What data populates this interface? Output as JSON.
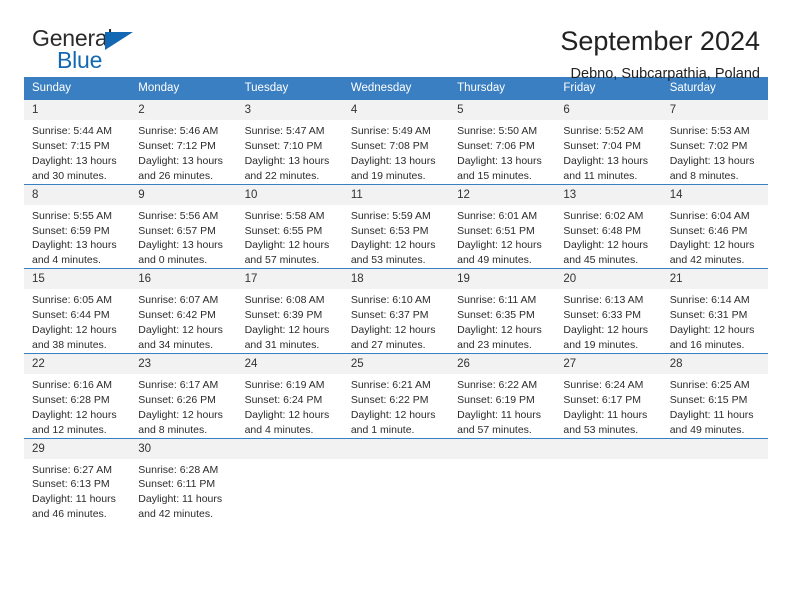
{
  "brand": {
    "name_top": "General",
    "name_bottom": "Blue",
    "accent_color": "#1268b3"
  },
  "header": {
    "title": "September 2024",
    "subtitle": "Debno, Subcarpathia, Poland"
  },
  "theme": {
    "header_blue": "#3a7fc1",
    "daynum_bg": "#f2f2f2",
    "text": "#222222"
  },
  "labels": {
    "sunrise_prefix": "Sunrise:",
    "sunset_prefix": "Sunset:",
    "daylight_prefix": "Daylight:"
  },
  "weekdays": [
    "Sunday",
    "Monday",
    "Tuesday",
    "Wednesday",
    "Thursday",
    "Friday",
    "Saturday"
  ],
  "weeks": [
    [
      {
        "day": "1",
        "sunrise": "Sunrise: 5:44 AM",
        "sunset": "Sunset: 7:15 PM",
        "daylight_line1": "Daylight: 13 hours",
        "daylight_line2": "and 30 minutes."
      },
      {
        "day": "2",
        "sunrise": "Sunrise: 5:46 AM",
        "sunset": "Sunset: 7:12 PM",
        "daylight_line1": "Daylight: 13 hours",
        "daylight_line2": "and 26 minutes."
      },
      {
        "day": "3",
        "sunrise": "Sunrise: 5:47 AM",
        "sunset": "Sunset: 7:10 PM",
        "daylight_line1": "Daylight: 13 hours",
        "daylight_line2": "and 22 minutes."
      },
      {
        "day": "4",
        "sunrise": "Sunrise: 5:49 AM",
        "sunset": "Sunset: 7:08 PM",
        "daylight_line1": "Daylight: 13 hours",
        "daylight_line2": "and 19 minutes."
      },
      {
        "day": "5",
        "sunrise": "Sunrise: 5:50 AM",
        "sunset": "Sunset: 7:06 PM",
        "daylight_line1": "Daylight: 13 hours",
        "daylight_line2": "and 15 minutes."
      },
      {
        "day": "6",
        "sunrise": "Sunrise: 5:52 AM",
        "sunset": "Sunset: 7:04 PM",
        "daylight_line1": "Daylight: 13 hours",
        "daylight_line2": "and 11 minutes."
      },
      {
        "day": "7",
        "sunrise": "Sunrise: 5:53 AM",
        "sunset": "Sunset: 7:02 PM",
        "daylight_line1": "Daylight: 13 hours",
        "daylight_line2": "and 8 minutes."
      }
    ],
    [
      {
        "day": "8",
        "sunrise": "Sunrise: 5:55 AM",
        "sunset": "Sunset: 6:59 PM",
        "daylight_line1": "Daylight: 13 hours",
        "daylight_line2": "and 4 minutes."
      },
      {
        "day": "9",
        "sunrise": "Sunrise: 5:56 AM",
        "sunset": "Sunset: 6:57 PM",
        "daylight_line1": "Daylight: 13 hours",
        "daylight_line2": "and 0 minutes."
      },
      {
        "day": "10",
        "sunrise": "Sunrise: 5:58 AM",
        "sunset": "Sunset: 6:55 PM",
        "daylight_line1": "Daylight: 12 hours",
        "daylight_line2": "and 57 minutes."
      },
      {
        "day": "11",
        "sunrise": "Sunrise: 5:59 AM",
        "sunset": "Sunset: 6:53 PM",
        "daylight_line1": "Daylight: 12 hours",
        "daylight_line2": "and 53 minutes."
      },
      {
        "day": "12",
        "sunrise": "Sunrise: 6:01 AM",
        "sunset": "Sunset: 6:51 PM",
        "daylight_line1": "Daylight: 12 hours",
        "daylight_line2": "and 49 minutes."
      },
      {
        "day": "13",
        "sunrise": "Sunrise: 6:02 AM",
        "sunset": "Sunset: 6:48 PM",
        "daylight_line1": "Daylight: 12 hours",
        "daylight_line2": "and 45 minutes."
      },
      {
        "day": "14",
        "sunrise": "Sunrise: 6:04 AM",
        "sunset": "Sunset: 6:46 PM",
        "daylight_line1": "Daylight: 12 hours",
        "daylight_line2": "and 42 minutes."
      }
    ],
    [
      {
        "day": "15",
        "sunrise": "Sunrise: 6:05 AM",
        "sunset": "Sunset: 6:44 PM",
        "daylight_line1": "Daylight: 12 hours",
        "daylight_line2": "and 38 minutes."
      },
      {
        "day": "16",
        "sunrise": "Sunrise: 6:07 AM",
        "sunset": "Sunset: 6:42 PM",
        "daylight_line1": "Daylight: 12 hours",
        "daylight_line2": "and 34 minutes."
      },
      {
        "day": "17",
        "sunrise": "Sunrise: 6:08 AM",
        "sunset": "Sunset: 6:39 PM",
        "daylight_line1": "Daylight: 12 hours",
        "daylight_line2": "and 31 minutes."
      },
      {
        "day": "18",
        "sunrise": "Sunrise: 6:10 AM",
        "sunset": "Sunset: 6:37 PM",
        "daylight_line1": "Daylight: 12 hours",
        "daylight_line2": "and 27 minutes."
      },
      {
        "day": "19",
        "sunrise": "Sunrise: 6:11 AM",
        "sunset": "Sunset: 6:35 PM",
        "daylight_line1": "Daylight: 12 hours",
        "daylight_line2": "and 23 minutes."
      },
      {
        "day": "20",
        "sunrise": "Sunrise: 6:13 AM",
        "sunset": "Sunset: 6:33 PM",
        "daylight_line1": "Daylight: 12 hours",
        "daylight_line2": "and 19 minutes."
      },
      {
        "day": "21",
        "sunrise": "Sunrise: 6:14 AM",
        "sunset": "Sunset: 6:31 PM",
        "daylight_line1": "Daylight: 12 hours",
        "daylight_line2": "and 16 minutes."
      }
    ],
    [
      {
        "day": "22",
        "sunrise": "Sunrise: 6:16 AM",
        "sunset": "Sunset: 6:28 PM",
        "daylight_line1": "Daylight: 12 hours",
        "daylight_line2": "and 12 minutes."
      },
      {
        "day": "23",
        "sunrise": "Sunrise: 6:17 AM",
        "sunset": "Sunset: 6:26 PM",
        "daylight_line1": "Daylight: 12 hours",
        "daylight_line2": "and 8 minutes."
      },
      {
        "day": "24",
        "sunrise": "Sunrise: 6:19 AM",
        "sunset": "Sunset: 6:24 PM",
        "daylight_line1": "Daylight: 12 hours",
        "daylight_line2": "and 4 minutes."
      },
      {
        "day": "25",
        "sunrise": "Sunrise: 6:21 AM",
        "sunset": "Sunset: 6:22 PM",
        "daylight_line1": "Daylight: 12 hours",
        "daylight_line2": "and 1 minute."
      },
      {
        "day": "26",
        "sunrise": "Sunrise: 6:22 AM",
        "sunset": "Sunset: 6:19 PM",
        "daylight_line1": "Daylight: 11 hours",
        "daylight_line2": "and 57 minutes."
      },
      {
        "day": "27",
        "sunrise": "Sunrise: 6:24 AM",
        "sunset": "Sunset: 6:17 PM",
        "daylight_line1": "Daylight: 11 hours",
        "daylight_line2": "and 53 minutes."
      },
      {
        "day": "28",
        "sunrise": "Sunrise: 6:25 AM",
        "sunset": "Sunset: 6:15 PM",
        "daylight_line1": "Daylight: 11 hours",
        "daylight_line2": "and 49 minutes."
      }
    ],
    [
      {
        "day": "29",
        "sunrise": "Sunrise: 6:27 AM",
        "sunset": "Sunset: 6:13 PM",
        "daylight_line1": "Daylight: 11 hours",
        "daylight_line2": "and 46 minutes."
      },
      {
        "day": "30",
        "sunrise": "Sunrise: 6:28 AM",
        "sunset": "Sunset: 6:11 PM",
        "daylight_line1": "Daylight: 11 hours",
        "daylight_line2": "and 42 minutes."
      },
      {
        "day": "",
        "sunrise": "",
        "sunset": "",
        "daylight_line1": "",
        "daylight_line2": ""
      },
      {
        "day": "",
        "sunrise": "",
        "sunset": "",
        "daylight_line1": "",
        "daylight_line2": ""
      },
      {
        "day": "",
        "sunrise": "",
        "sunset": "",
        "daylight_line1": "",
        "daylight_line2": ""
      },
      {
        "day": "",
        "sunrise": "",
        "sunset": "",
        "daylight_line1": "",
        "daylight_line2": ""
      },
      {
        "day": "",
        "sunrise": "",
        "sunset": "",
        "daylight_line1": "",
        "daylight_line2": ""
      }
    ]
  ]
}
